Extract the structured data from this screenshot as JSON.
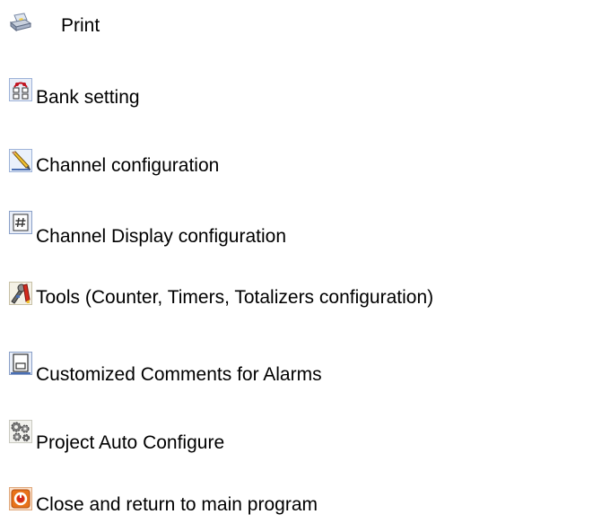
{
  "legend": {
    "items": [
      {
        "icon": "printer-icon",
        "label": "Print"
      },
      {
        "icon": "bank-setting-icon",
        "label": "Bank setting"
      },
      {
        "icon": "pencil-icon",
        "label": "Channel configuration"
      },
      {
        "icon": "display-grid-icon",
        "label": "Channel Display configuration"
      },
      {
        "icon": "tools-icon",
        "label": "Tools (Counter, Timers, Totalizers configuration)"
      },
      {
        "icon": "comment-document-icon",
        "label": "Customized Comments for Alarms"
      },
      {
        "icon": "gears-icon",
        "label": "Project Auto Configure"
      },
      {
        "icon": "power-close-icon",
        "label": "Close and return to main program"
      }
    ]
  },
  "colors": {
    "text": "#000000",
    "background": "#ffffff",
    "icon_frame": "#9db2d8",
    "icon_fill": "#e8edf7",
    "bank_red": "#c1121f",
    "pencil_yellow": "#f2c230",
    "close_orange": "#e8731a",
    "close_red": "#d42a1d"
  }
}
